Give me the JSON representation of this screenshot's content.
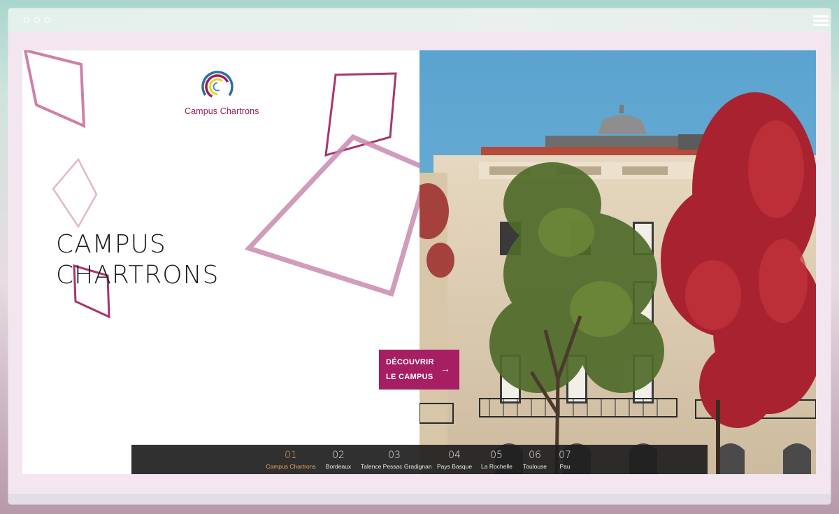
{
  "window": {
    "traffic_lights": [
      "circle-1",
      "circle-2",
      "circle-3"
    ],
    "menu_icon": "hamburger-icon"
  },
  "brand": {
    "logo_text": "Campus Chartrons",
    "colors": {
      "accent": "#a61e63",
      "active_slide": "#e8a35f",
      "logo_purple": "#9b1d5a",
      "logo_blue": "#2f6fa0",
      "logo_yellow": "#f0d21a"
    }
  },
  "hero": {
    "title_line1": "CAMPUS",
    "title_line2": "CHARTRONS"
  },
  "cta": {
    "line1": "DÉCOUVRIR",
    "line2": "LE CAMPUS",
    "icon": "arrow-right-icon"
  },
  "slides": [
    {
      "num": "01",
      "label": "Campus Chartrons",
      "active": true
    },
    {
      "num": "02",
      "label": "Bordeaux",
      "active": false
    },
    {
      "num": "03",
      "label": "Talence Pessac Gradignan",
      "active": false
    },
    {
      "num": "04",
      "label": "Pays Basque",
      "active": false
    },
    {
      "num": "05",
      "label": "La Rochelle",
      "active": false
    },
    {
      "num": "06",
      "label": "Toulouse",
      "active": false
    },
    {
      "num": "07",
      "label": "Pau",
      "active": false
    }
  ]
}
